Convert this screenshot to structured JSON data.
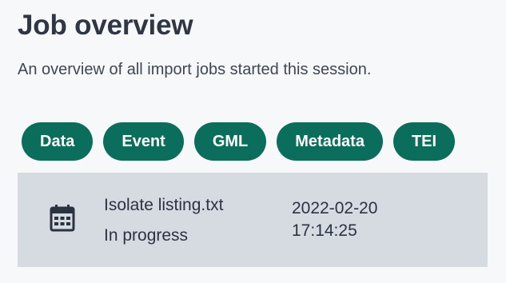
{
  "header": {
    "title": "Job overview",
    "subtitle": "An overview of all import jobs started this session."
  },
  "filters": [
    {
      "label": "Data"
    },
    {
      "label": "Event"
    },
    {
      "label": "GML"
    },
    {
      "label": "Metadata"
    },
    {
      "label": "TEI"
    }
  ],
  "jobs": [
    {
      "icon": "calendar-icon",
      "name": "Isolate listing.txt",
      "status": "In progress",
      "date": "2022-02-20",
      "time": "17:14:25"
    }
  ],
  "colors": {
    "chip_background": "#0b6e5d",
    "chip_text": "#ffffff",
    "card_background": "#d5dbe1",
    "page_background": "#f7f8fa",
    "text": "#2b3240"
  }
}
